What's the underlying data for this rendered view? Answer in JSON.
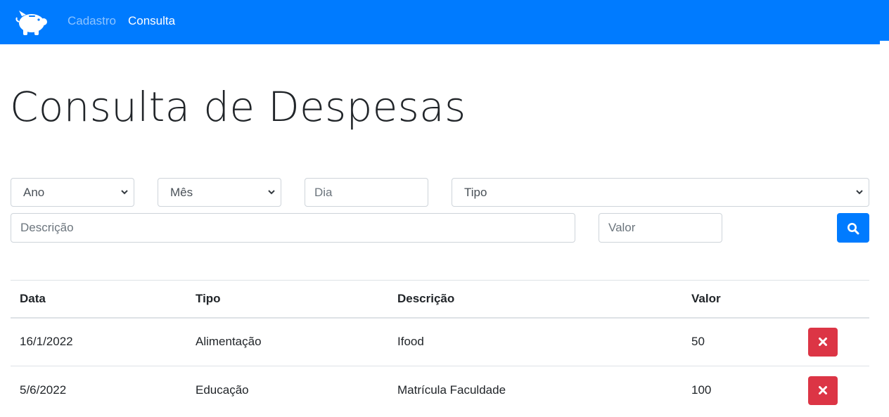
{
  "nav": {
    "brand_icon": "piggy-bank-icon",
    "links": [
      {
        "label": "Cadastro",
        "active": false
      },
      {
        "label": "Consulta",
        "active": true
      }
    ],
    "color": "#007bff"
  },
  "page": {
    "title": "Consulta de Despesas"
  },
  "filters": {
    "ano": {
      "selected": "Ano"
    },
    "mes": {
      "selected": "Mês"
    },
    "dia": {
      "placeholder": "Dia"
    },
    "tipo": {
      "selected": "Tipo"
    },
    "descricao": {
      "placeholder": "Descrição"
    },
    "valor": {
      "placeholder": "Valor"
    },
    "search_icon": "search-icon"
  },
  "table": {
    "headers": [
      "Data",
      "Tipo",
      "Descrição",
      "Valor"
    ],
    "rows": [
      {
        "data": "16/1/2022",
        "tipo": "Alimentação",
        "descricao": "Ifood",
        "valor": "50"
      },
      {
        "data": "5/6/2022",
        "tipo": "Educação",
        "descricao": "Matrícula Faculdade",
        "valor": "100"
      }
    ],
    "delete_icon": "close-icon",
    "delete_color": "#dc3545"
  }
}
